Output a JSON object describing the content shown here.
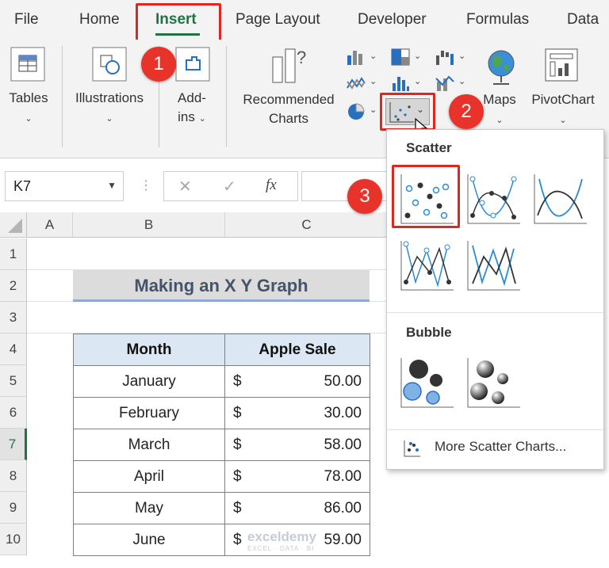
{
  "tabs": [
    "File",
    "Home",
    "Insert",
    "Page Layout",
    "Developer",
    "Formulas",
    "Data"
  ],
  "ribbon": {
    "tables": "Tables",
    "illustrations": "Illustrations",
    "addins_line1": "Add-",
    "addins_line2": "ins",
    "recommended_line1": "Recommended",
    "recommended_line2": "Charts",
    "maps": "Maps",
    "pivotchart": "PivotChart"
  },
  "badges": [
    "1",
    "2",
    "3"
  ],
  "formula_bar": {
    "name_box": "K7",
    "fx": "fx"
  },
  "columns": [
    "A",
    "B",
    "C"
  ],
  "rows": [
    "1",
    "2",
    "3",
    "4",
    "5",
    "6",
    "7",
    "8",
    "9",
    "10"
  ],
  "sheet": {
    "title": "Making an X Y Graph",
    "headers": [
      "Month",
      "Apple Sale"
    ],
    "rows": [
      {
        "month": "January",
        "cur": "$",
        "amt": "50.00"
      },
      {
        "month": "February",
        "cur": "$",
        "amt": "30.00"
      },
      {
        "month": "March",
        "cur": "$",
        "amt": "58.00"
      },
      {
        "month": "April",
        "cur": "$",
        "amt": "78.00"
      },
      {
        "month": "May",
        "cur": "$",
        "amt": "86.00"
      },
      {
        "month": "June",
        "cur": "$",
        "amt": "59.00"
      }
    ]
  },
  "gallery": {
    "scatter_title": "Scatter",
    "bubble_title": "Bubble",
    "more": "More Scatter Charts..."
  },
  "watermark": {
    "brand": "exceldemy",
    "tagline": "EXCEL · DATA · BI"
  },
  "colors": {
    "accent": "#217346",
    "highlight": "#e0261f",
    "badge": "#e8332b"
  }
}
